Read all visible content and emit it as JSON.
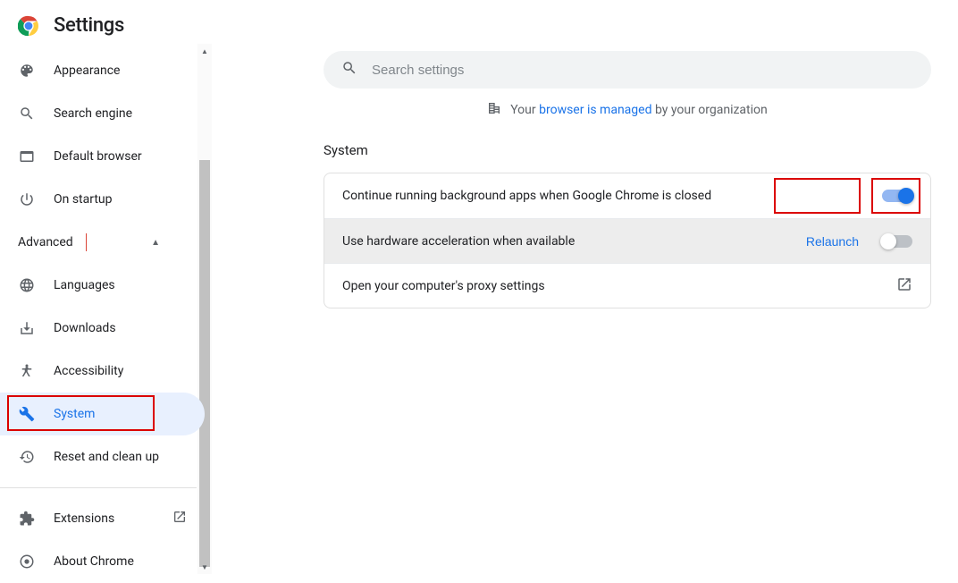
{
  "header": {
    "title": "Settings"
  },
  "search": {
    "placeholder": "Search settings"
  },
  "managed": {
    "prefix": "Your ",
    "link": "browser is managed",
    "suffix": " by your organization"
  },
  "sidebar": {
    "items": [
      {
        "label": "Appearance"
      },
      {
        "label": "Search engine"
      },
      {
        "label": "Default browser"
      },
      {
        "label": "On startup"
      }
    ],
    "advanced_label": "Advanced",
    "advanced_items": [
      {
        "label": "Languages"
      },
      {
        "label": "Downloads"
      },
      {
        "label": "Accessibility"
      },
      {
        "label": "System"
      },
      {
        "label": "Reset and clean up"
      }
    ],
    "footer": [
      {
        "label": "Extensions"
      },
      {
        "label": "About Chrome"
      }
    ]
  },
  "section": {
    "title": "System",
    "rows": [
      {
        "label": "Continue running background apps when Google Chrome is closed"
      },
      {
        "label": "Use hardware acceleration when available",
        "relaunch": "Relaunch"
      },
      {
        "label": "Open your computer's proxy settings"
      }
    ]
  }
}
